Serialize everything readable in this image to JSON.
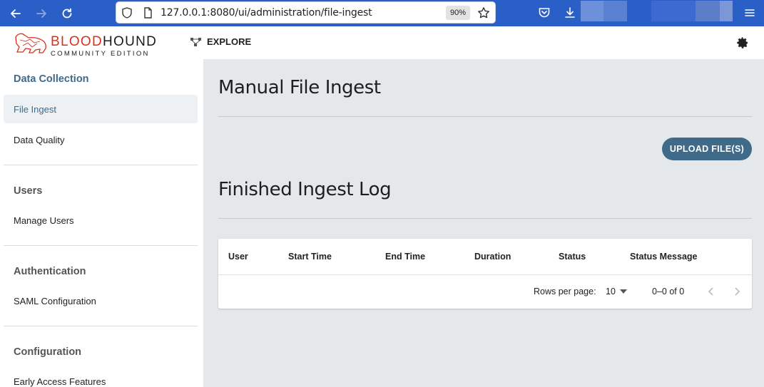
{
  "browser": {
    "url": "127.0.0.1:8080/ui/administration/file-ingest",
    "zoom": "90%",
    "icons": [
      "back-arrow-icon",
      "forward-arrow-icon",
      "reload-icon",
      "shield-icon",
      "page-icon",
      "bookmark-star-icon",
      "pocket-icon",
      "download-icon",
      "menu-icon"
    ]
  },
  "header": {
    "logo_word_red": "BLOOD",
    "logo_word_dark": "HOUND",
    "logo_sub": "COMMUNITY EDITION",
    "explore_label": "EXPLORE"
  },
  "sidebar": {
    "sections": [
      {
        "title": "Data Collection",
        "items": [
          "File Ingest",
          "Data Quality"
        ]
      },
      {
        "title": "Users",
        "items": [
          "Manage Users"
        ]
      },
      {
        "title": "Authentication",
        "items": [
          "SAML Configuration"
        ]
      },
      {
        "title": "Configuration",
        "items": [
          "Early Access Features"
        ]
      }
    ],
    "active_item": "File Ingest"
  },
  "main": {
    "title": "Manual File Ingest",
    "upload_button": "UPLOAD FILE(S)",
    "log_title": "Finished Ingest Log",
    "table": {
      "columns": [
        "User",
        "Start Time",
        "End Time",
        "Duration",
        "Status",
        "Status Message"
      ],
      "rows": []
    },
    "pagination": {
      "rows_per_page_label": "Rows per page:",
      "rows_per_page_value": "10",
      "range": "0–0 of 0"
    }
  },
  "colors": {
    "browser_bar": "#2b5fc8",
    "accent": "#3f6a8a",
    "brand_red": "#d9301d",
    "main_bg": "#e4e8ea"
  }
}
